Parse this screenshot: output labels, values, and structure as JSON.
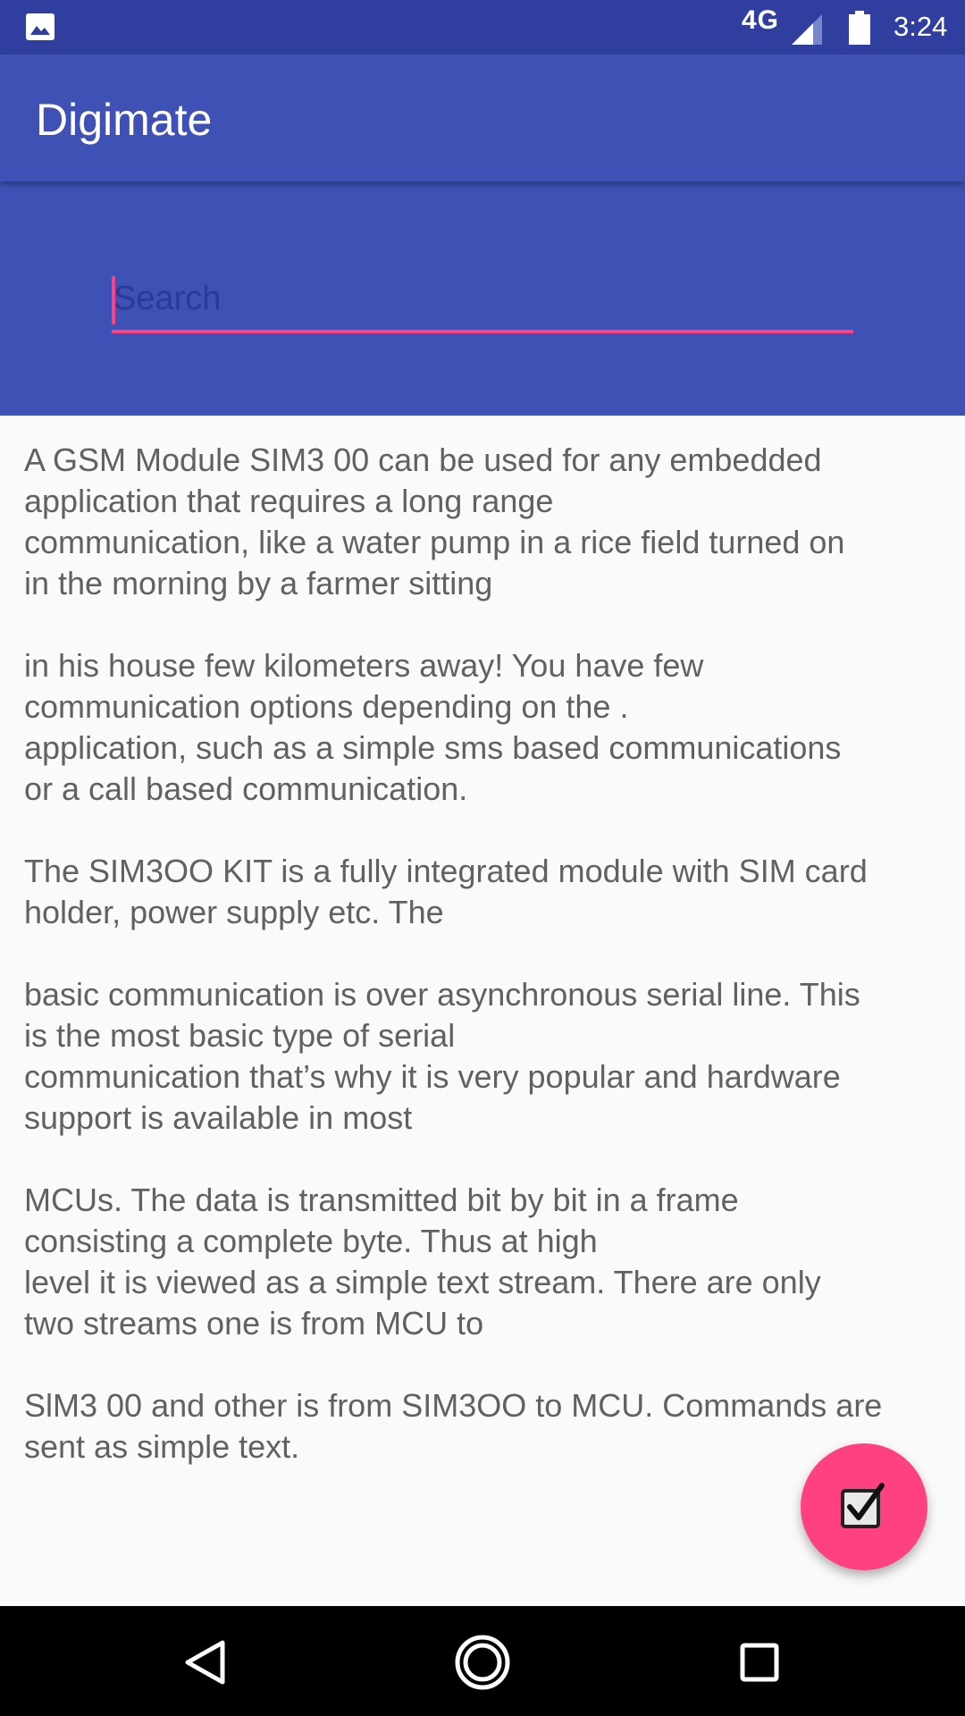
{
  "status_bar": {
    "network_type": "4G",
    "time": "3:24",
    "icons": [
      "gallery-icon",
      "signal-icon",
      "battery-icon"
    ]
  },
  "app_bar": {
    "title": "Digimate"
  },
  "search": {
    "placeholder": "Search",
    "value": ""
  },
  "content": {
    "paragraphs": [
      "A GSM Module SIM3 00 can be used for any embedded\napplication that requires a long range\ncommunication, like a water pump in a rice field turned on\nin the morning by a farmer sitting",
      "in his house few kilometers away! You have few\ncommunication options depending on the .\napplication, such as a simple sms based communications\nor a call based communication.",
      "The SIM3OO KIT is a fully integrated module with SIM card\nholder, power supply etc. The",
      "basic communication is over asynchronous serial line. This\nis the most basic type of serial\ncommunication that’s why it is very popular and hardware\nsupport is available in most",
      "MCUs. The data is transmitted bit by bit in a frame\nconsisting a complete byte. Thus at high\nlevel it is viewed as a simple text stream. There are only\ntwo streams one is from MCU to",
      "SlM3 00 and other is from SIM3OO to MCU. Commands are\nsent as simple text."
    ]
  },
  "fab": {
    "icon": "checkbox-icon"
  },
  "nav_bar": {
    "icons": [
      "back-icon",
      "home-icon",
      "recents-icon"
    ]
  },
  "colors": {
    "status_bar": "#303f9f",
    "primary": "#3f51b5",
    "accent": "#ff4081",
    "body_text": "#616161",
    "background": "#fafafa"
  }
}
